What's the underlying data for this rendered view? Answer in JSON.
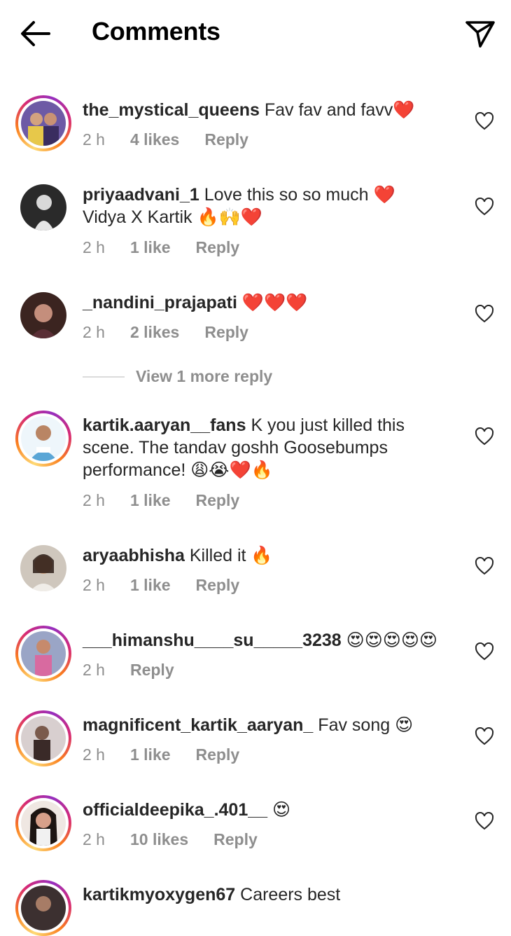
{
  "header": {
    "title": "Comments",
    "back_icon": "arrow-left-icon",
    "send_icon": "paper-plane-icon"
  },
  "colors": {
    "text": "#262626",
    "muted": "#8e8e8e",
    "heart": "#e0245e",
    "ring_start": "#feda75",
    "ring_end": "#962fbf"
  },
  "comments": [
    {
      "username": "the_mystical_queens",
      "text": "Fav fav and favv",
      "emoji": "❤️",
      "time": "2 h",
      "likes": "4 likes",
      "reply": "Reply",
      "story_ring": true
    },
    {
      "username": "priyaadvani_1",
      "text": "Love this so so much ",
      "text2": "Vidya X Kartik ",
      "emoji": "❤️",
      "emoji2": "🔥🙌❤️",
      "time": "2 h",
      "likes": "1 like",
      "reply": "Reply",
      "story_ring": false
    },
    {
      "username": "_nandini_prajapati",
      "text": "",
      "emoji": "❤️❤️❤️",
      "time": "2 h",
      "likes": "2 likes",
      "reply": "Reply",
      "story_ring": false
    },
    {
      "username": "kartik.aaryan__fans",
      "text": "K you just killed this scene. The tandav  goshh Goosebumps performance! ",
      "emoji": "😩😭❤️🔥",
      "time": "2 h",
      "likes": "1 like",
      "reply": "Reply",
      "story_ring": true
    },
    {
      "username": "aryaabhisha",
      "text": "Killed it ",
      "emoji": "🔥",
      "time": "2 h",
      "likes": "1 like",
      "reply": "Reply",
      "story_ring": false
    },
    {
      "username": "___himanshu____su_____3238",
      "text": "",
      "emoji": "😍😍😍😍😍",
      "time": "2 h",
      "likes": "",
      "reply": "Reply",
      "story_ring": true
    },
    {
      "username": "magnificent_kartik_aaryan_",
      "text": "Fav song ",
      "emoji": "😍",
      "time": "2 h",
      "likes": "1 like",
      "reply": "Reply",
      "story_ring": true
    },
    {
      "username": "officialdeepika_.401__",
      "text": "",
      "emoji": "😍",
      "time": "2 h",
      "likes": "10 likes",
      "reply": "Reply",
      "story_ring": true
    },
    {
      "username": "kartikmyoxygen67",
      "text": "Careers best",
      "emoji": "",
      "time": "",
      "likes": "",
      "reply": "",
      "story_ring": true
    }
  ],
  "view_more": "View 1 more reply"
}
